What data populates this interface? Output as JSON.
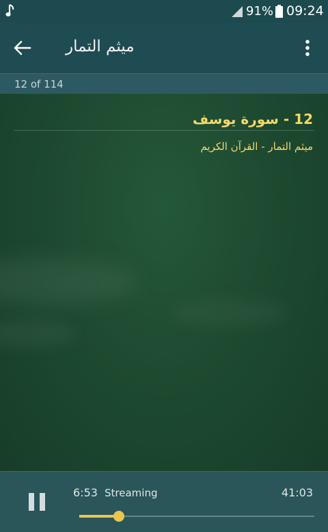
{
  "status_bar": {
    "battery_percent": "91%",
    "time": "09:24",
    "icons": [
      "music-note-icon",
      "signal-icon",
      "battery-icon"
    ]
  },
  "app_bar": {
    "title": "ميثم التمار",
    "icons": [
      "back-arrow-icon",
      "more-vert-icon"
    ]
  },
  "track_counter": "12 of 114",
  "now_playing": {
    "title": "12 - سورة يوسف",
    "subtitle": "ميثم التمار - القرآن الكريم"
  },
  "player": {
    "elapsed": "6:53",
    "status": "Streaming",
    "duration": "41:03",
    "progress_fraction": 0.168,
    "accent_color": "#e9c650",
    "icons": [
      "pause-icon"
    ]
  }
}
